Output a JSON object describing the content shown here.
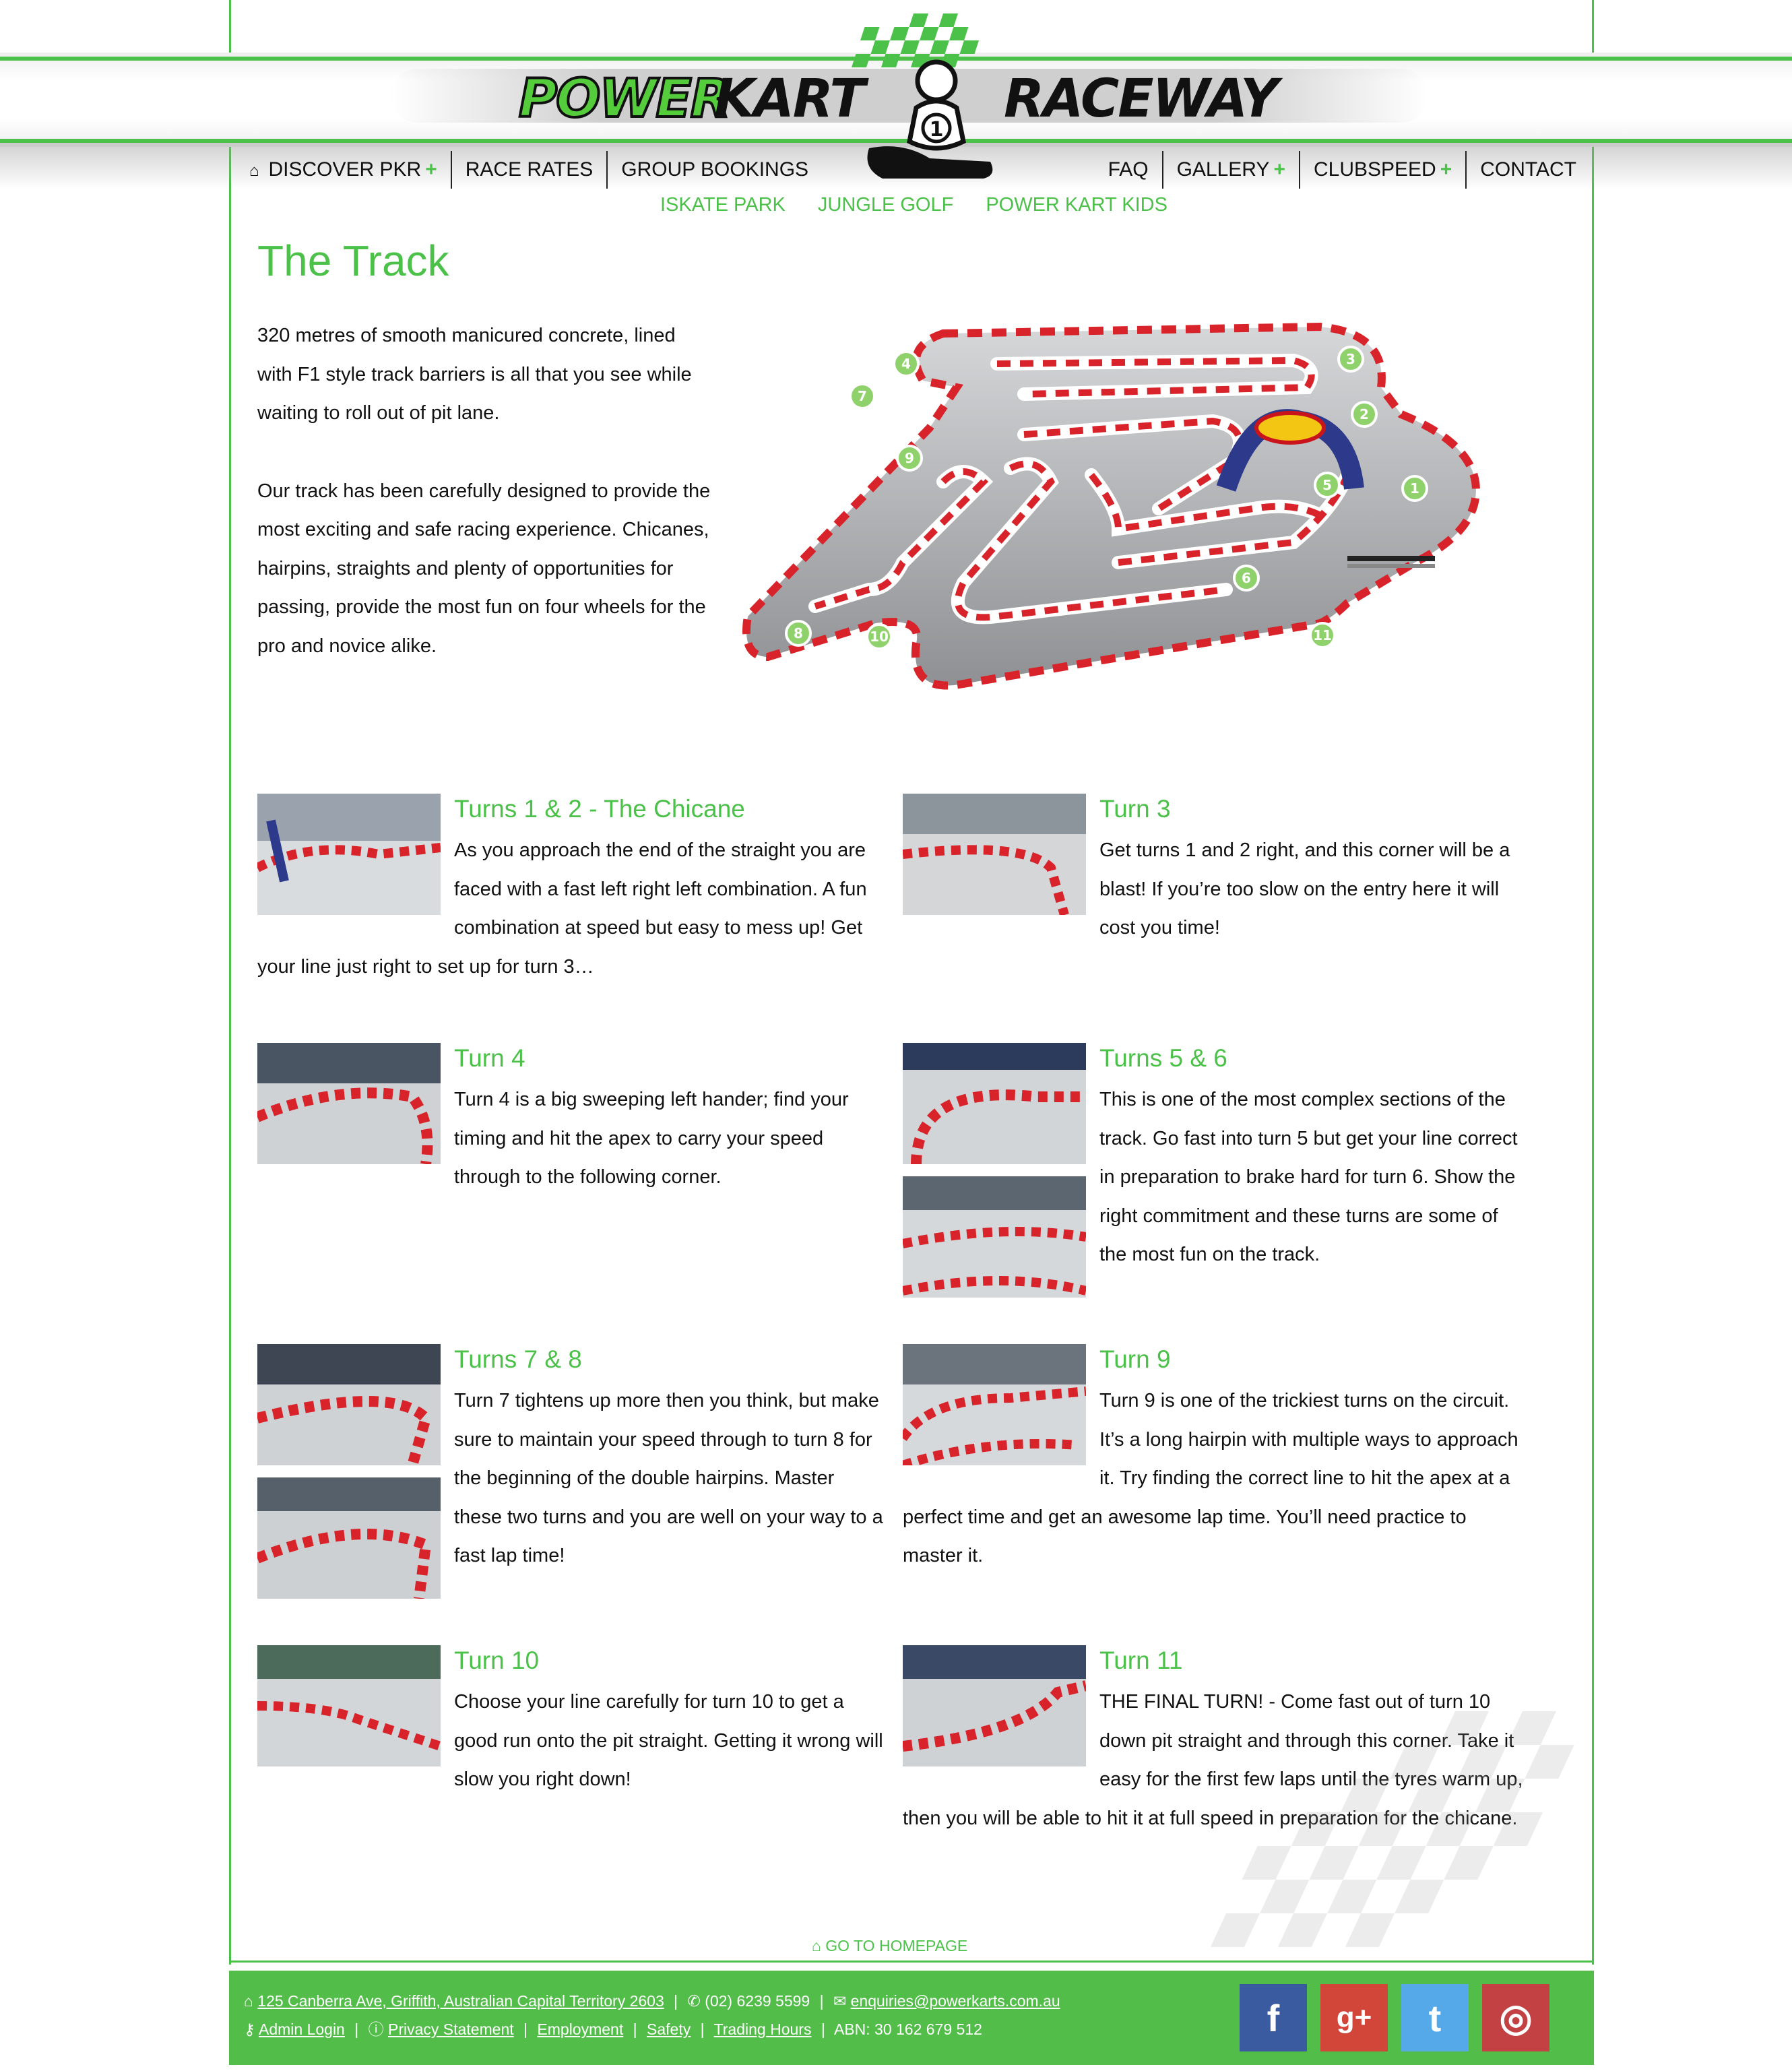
{
  "logo": {
    "power": "POWER",
    "kart": "KART",
    "raceway": "RACEWAY",
    "kart_number": "1"
  },
  "nav": {
    "left": [
      {
        "label": "DISCOVER PKR",
        "plus": "+",
        "icon": "home-icon"
      },
      {
        "label": "RACE RATES"
      },
      {
        "label": "GROUP BOOKINGS"
      }
    ],
    "right": [
      {
        "label": "FAQ"
      },
      {
        "label": "GALLERY",
        "plus": "+"
      },
      {
        "label": "CLUBSPEED",
        "plus": "+"
      },
      {
        "label": "CONTACT"
      }
    ],
    "sub": [
      "ISKATE PARK",
      "JUNGLE GOLF",
      "POWER KART KIDS"
    ]
  },
  "page": {
    "title": "The Track",
    "intro": [
      "320 metres of smooth manicured concrete, lined with F1 style track barriers is all that you see while waiting to roll out of pit lane.",
      "Our track has been carefully designed to provide the most exciting and safe racing experience. Chicanes, hairpins, straights and plenty of opportunities for passing, provide the most fun on four wheels for the pro and novice alike."
    ]
  },
  "track_map": {
    "turn_numbers": [
      "1",
      "2",
      "3",
      "4",
      "5",
      "6",
      "7",
      "8",
      "9",
      "10",
      "11"
    ],
    "colors": {
      "surface": "#b8b9bb",
      "barrier_red": "#d8232a",
      "turn_badge": "#8fd16a"
    }
  },
  "turns": [
    {
      "title": "Turns 1 & 2 - The Chicane",
      "text": "As you approach the end of the straight you are faced with a fast left right left combination. A fun combination at speed but easy to mess up! Get your line just right to set up for turn 3…"
    },
    {
      "title": "Turn 3",
      "text": "Get turns 1 and 2 right, and this corner will be a blast! If you’re too slow on the entry here it will cost you time!"
    },
    {
      "title": "Turn 4",
      "text": "Turn 4 is a big sweeping left hander; find your timing and hit the apex to carry your speed through to the following corner."
    },
    {
      "title": "Turns 5 & 6",
      "text": "This is one of the most complex sections of the track. Go fast into turn 5 but get your line correct in preparation to brake hard for turn 6. Show the right commitment and these turns are some of the most fun on the track."
    },
    {
      "title": "Turns 7 & 8",
      "text": "Turn 7 tightens up more then you think, but make sure to maintain your speed through to turn 8 for the beginning of the double hairpins. Master these two turns and you are well on your way to a fast lap time!"
    },
    {
      "title": "Turn 9",
      "text": "Turn 9 is one of the trickiest turns on the circuit. It’s a long hairpin with multiple ways to approach it. Try finding the correct line to hit the apex at a perfect time and get an awesome lap time. You’ll need practice to master it."
    },
    {
      "title": "Turn 10",
      "text": "Choose your line carefully for turn 10 to get a good run onto the pit straight. Getting it wrong will slow you right down!"
    },
    {
      "title": "Turn 11",
      "text": "THE FINAL TURN! - Come fast out of turn 10 down pit straight and through this corner. Take it easy for the first few laps until the tyres warm up, then you will be able to hit it at full speed in preparation for the chicane."
    }
  ],
  "goto_home": "GO TO HOMEPAGE",
  "footer": {
    "address": "125 Canberra Ave, Griffith, Australian Capital Territory 2603",
    "phone": "(02) 6239 5599",
    "email": "enquiries@powerkarts.com.au",
    "admin_login": "Admin Login",
    "privacy": "Privacy Statement",
    "employment": "Employment",
    "safety": "Safety",
    "trading_hours": "Trading Hours",
    "abn": "ABN: 30 162 679 512",
    "sep": "|",
    "social": [
      {
        "name": "facebook",
        "glyph": "f",
        "color": "#3b5ba0"
      },
      {
        "name": "google-plus",
        "glyph": "g+",
        "color": "#d2463a"
      },
      {
        "name": "twitter",
        "glyph": "t",
        "color": "#55a9e8"
      },
      {
        "name": "instagram",
        "glyph": "◎",
        "color": "#c34043"
      }
    ]
  }
}
